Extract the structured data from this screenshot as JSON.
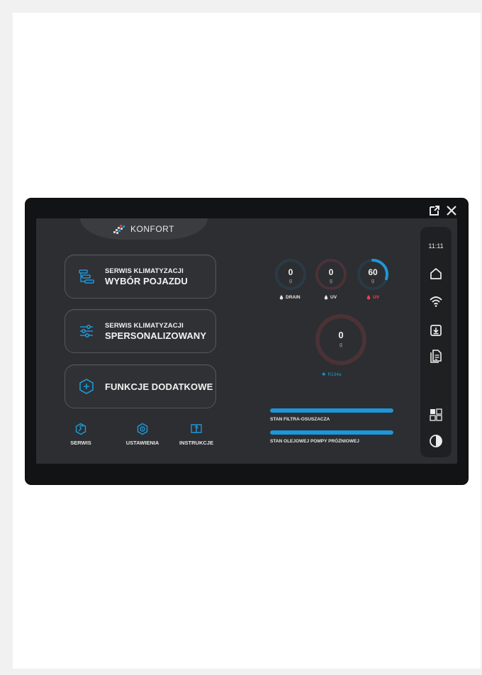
{
  "header": {
    "external_icon": "open-in-new-icon",
    "close_icon": "close-icon"
  },
  "logo": {
    "text": "KONFORT"
  },
  "menu": [
    {
      "line1": "SERWIS KLIMATYZACJI",
      "line2": "WYBÓR POJAZDU",
      "icon": "vehicle-list-icon"
    },
    {
      "line1": "SERWIS KLIMATYZACJI",
      "line2": "SPERSONALIZOWANY",
      "icon": "sliders-icon"
    },
    {
      "line1": "",
      "line2": "FUNKCJE DODATKOWE",
      "icon": "plus-hexagon-icon"
    }
  ],
  "bottom_nav": [
    {
      "label": "SERWIS",
      "icon": "wrench-hexagon-icon"
    },
    {
      "label": "USTAWIENIA",
      "icon": "gear-hexagon-icon"
    },
    {
      "label": "INSTRUKCJE",
      "icon": "manual-book-icon"
    }
  ],
  "gauges": [
    {
      "value": "0",
      "unit": "g",
      "label": "DRAIN",
      "fraction": 0,
      "label_color": "#e6e6e6"
    },
    {
      "value": "0",
      "unit": "g",
      "label": "UV",
      "fraction": 0,
      "label_color": "#e6e6e6"
    },
    {
      "value": "60",
      "unit": "g",
      "label": "UV",
      "fraction": 0.3,
      "label_color": "#ff3b5c"
    }
  ],
  "big_gauge": {
    "value": "0",
    "unit": "g",
    "label": "R134a",
    "fraction": 0
  },
  "status_bars": [
    {
      "label": "STAN FILTRA-OSUSZACZA",
      "fraction": 1.0
    },
    {
      "label": "STAN OLEJOWEJ POMPY PRÓŻNIOWEJ",
      "fraction": 1.0
    }
  ],
  "side_panel": {
    "time": "11:11",
    "icons": [
      "home-icon",
      "wifi-icon",
      "download-icon",
      "documents-icon",
      "grid-icon",
      "contrast-icon"
    ]
  },
  "colors": {
    "accent": "#1e96d8",
    "gauge_track": "#3c4a55",
    "gauge_track_red": "#4a3236",
    "alert": "#ff3b5c"
  }
}
